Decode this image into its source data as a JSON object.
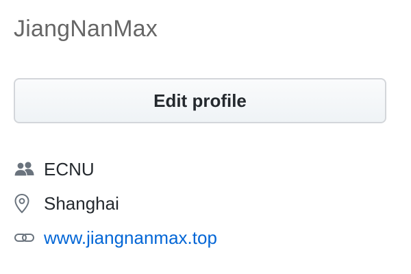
{
  "profile": {
    "username": "JiangNanMax",
    "edit_button_label": "Edit profile"
  },
  "details": {
    "organization": {
      "icon": "people-icon",
      "text": "ECNU"
    },
    "location": {
      "icon": "location-pin-icon",
      "text": "Shanghai"
    },
    "website": {
      "icon": "link-icon",
      "text": "www.jiangnanmax.top"
    }
  },
  "colors": {
    "username": "#666666",
    "text": "#24292e",
    "link": "#0366d6",
    "icon": "#6a737d",
    "button_border": "#d3d6da"
  }
}
